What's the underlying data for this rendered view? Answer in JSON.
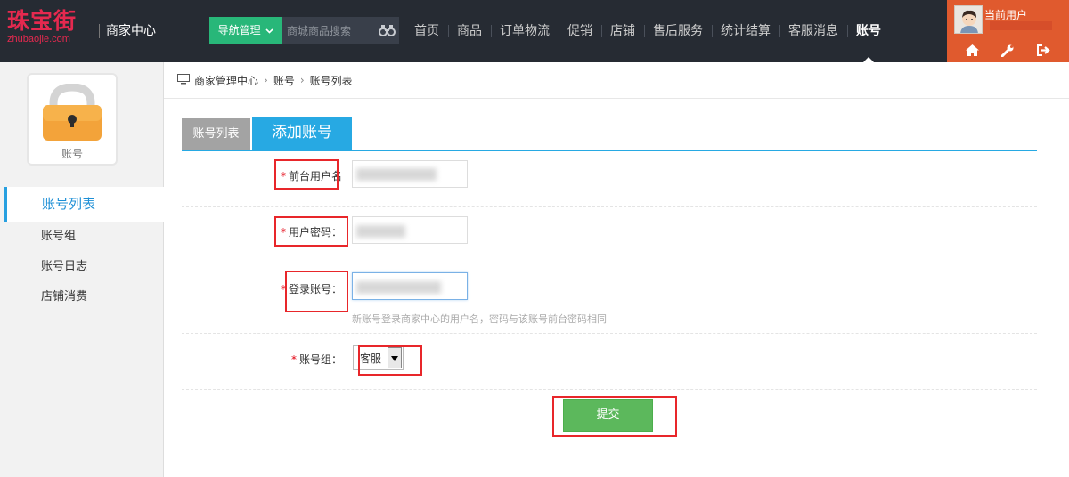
{
  "header": {
    "logo_text": "珠宝街",
    "logo_domain": "zhubaojie.com",
    "center_title": "商家中心",
    "nav_button": "导航管理",
    "search_placeholder": "商城商品搜索",
    "menu": [
      "首页",
      "商品",
      "订单物流",
      "促销",
      "店铺",
      "售后服务",
      "统计结算",
      "客服消息",
      "账号"
    ],
    "active_menu": "账号",
    "user_label": "当前用户",
    "user_icons": [
      "home-icon",
      "wrench-icon",
      "logout-icon"
    ]
  },
  "sidebar": {
    "module_label": "账号",
    "items": [
      "账号列表",
      "账号组",
      "账号日志",
      "店铺消费"
    ],
    "active_item": "账号列表"
  },
  "breadcrumb": [
    "商家管理中心",
    "账号",
    "账号列表"
  ],
  "tabs": [
    "账号列表",
    "添加账号"
  ],
  "form": {
    "required_mark": "*",
    "username_label": "前台用户名",
    "password_label": "用户密码：",
    "login_label": "登录账号：",
    "login_hint": "新账号登录商家中心的用户名，密码与该账号前台密码相同",
    "group_label": "账号组：",
    "group_value": "客服",
    "submit": "提交"
  },
  "colors": {
    "topbar": "#262b33",
    "green": "#28b779",
    "user_box": "#e05a2e",
    "tab_active": "#27a9e3",
    "submit": "#5cb85c",
    "highlight": "#e8262a"
  }
}
